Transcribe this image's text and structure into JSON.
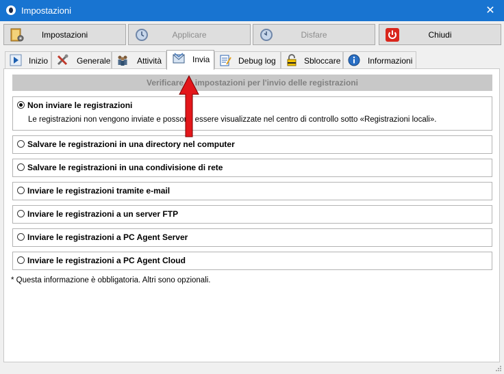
{
  "window": {
    "title": "Impostazioni",
    "close_symbol": "✕"
  },
  "toolbar": {
    "settings_label": "Impostazioni",
    "apply_label": "Applicare",
    "undo_label": "Disfare",
    "close_label": "Chiudi"
  },
  "tabs": [
    {
      "label": "Inizio",
      "icon": "play-icon"
    },
    {
      "label": "Generale",
      "icon": "tools-icon"
    },
    {
      "label": "Attività",
      "icon": "people-icon"
    },
    {
      "label": "Invia",
      "icon": "envelope-icon"
    },
    {
      "label": "Debug log",
      "icon": "notepad-icon"
    },
    {
      "label": "Sbloccare",
      "icon": "padlock-icon"
    },
    {
      "label": "Informazioni",
      "icon": "info-icon"
    }
  ],
  "active_tab": "Invia",
  "panel": {
    "header": "Verificare le impostazioni per l'invio delle registrazioni",
    "options": [
      {
        "label": "Non inviare le registrazioni",
        "checked": true,
        "description": "Le registrazioni non vengono inviate e possono essere visualizzate nel centro di controllo sotto «Registrazioni locali»."
      },
      {
        "label": "Salvare le registrazioni in una directory nel computer",
        "checked": false
      },
      {
        "label": "Salvare le registrazioni in una condivisione di rete",
        "checked": false
      },
      {
        "label": "Inviare le registrazioni tramite e-mail",
        "checked": false
      },
      {
        "label": "Inviare le registrazioni a un server FTP",
        "checked": false
      },
      {
        "label": "Inviare le registrazioni a PC Agent Server",
        "checked": false
      },
      {
        "label": "Inviare le registrazioni a PC Agent Cloud",
        "checked": false
      }
    ],
    "footnote": "* Questa informazione è obbligatoria. Altri sono opzionali."
  },
  "colors": {
    "titlebar": "#1874d1",
    "annotation_arrow": "#e3171b"
  }
}
